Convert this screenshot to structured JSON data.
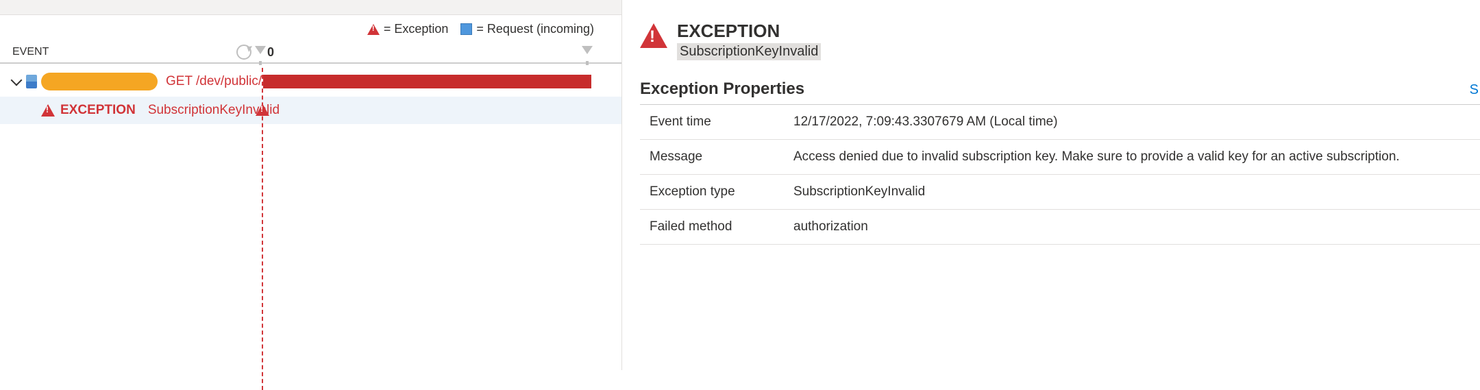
{
  "legend": {
    "exception": "= Exception",
    "request": "= Request (incoming)"
  },
  "timeline": {
    "header": "EVENT",
    "zero": "0",
    "request_text": "GET /dev/public/",
    "exception_label": "EXCEPTION",
    "exception_type": "SubscriptionKeyInvalid"
  },
  "detail": {
    "title": "EXCEPTION",
    "subtitle": "SubscriptionKeyInvalid",
    "section": "Exception Properties",
    "link": "S",
    "props": [
      {
        "key": "Event time",
        "val": "12/17/2022, 7:09:43.3307679 AM (Local time)"
      },
      {
        "key": "Message",
        "val": "Access denied due to invalid subscription key. Make sure to provide a valid key for an active subscription."
      },
      {
        "key": "Exception type",
        "val": "SubscriptionKeyInvalid"
      },
      {
        "key": "Failed method",
        "val": "authorization"
      }
    ]
  }
}
